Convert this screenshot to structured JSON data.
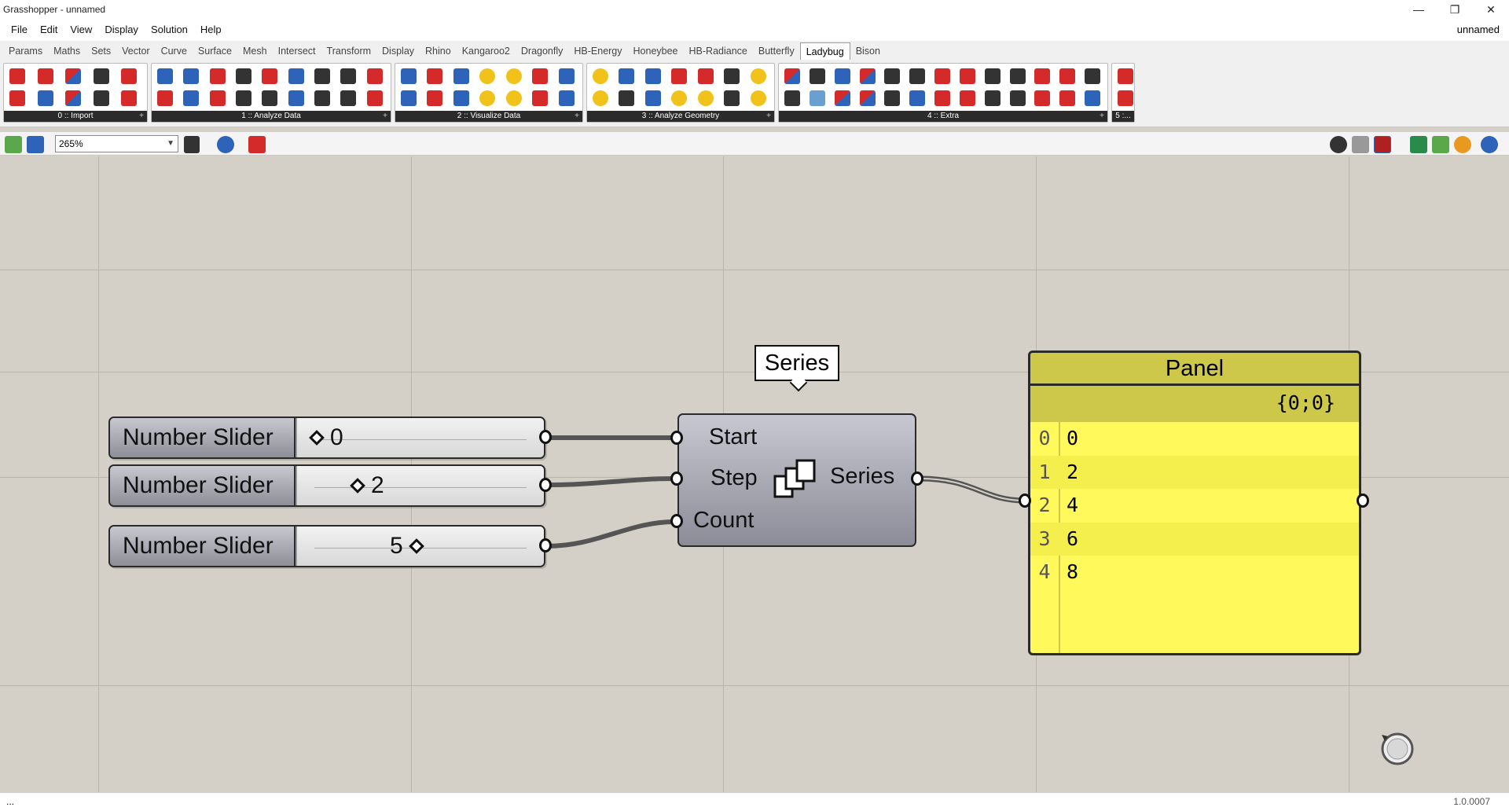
{
  "window": {
    "title": "Grasshopper - unnamed",
    "minimize": "—",
    "restore": "❐",
    "close": "✕"
  },
  "menu": {
    "items": [
      "File",
      "Edit",
      "View",
      "Display",
      "Solution",
      "Help"
    ],
    "doc_name": "unnamed"
  },
  "tabs": {
    "items": [
      "Params",
      "Maths",
      "Sets",
      "Vector",
      "Curve",
      "Surface",
      "Mesh",
      "Intersect",
      "Transform",
      "Display",
      "Rhino",
      "Kangaroo2",
      "Dragonfly",
      "HB-Energy",
      "Honeybee",
      "HB-Radiance",
      "Butterfly",
      "Ladybug",
      "Bison"
    ],
    "active": "Ladybug"
  },
  "ribbon": {
    "groups": [
      {
        "label": "0 :: Import"
      },
      {
        "label": "1 :: Analyze Data"
      },
      {
        "label": "2 :: Visualize Data"
      },
      {
        "label": "3 :: Analyze Geometry"
      },
      {
        "label": "4 :: Extra"
      },
      {
        "label": "5 :..."
      }
    ]
  },
  "canvas_toolbar": {
    "zoom": "265%"
  },
  "sliders": [
    {
      "label": "Number Slider",
      "value": "0"
    },
    {
      "label": "Number Slider",
      "value": "2"
    },
    {
      "label": "Number Slider",
      "value": "5"
    }
  ],
  "series": {
    "tooltip": "Series",
    "inputs": [
      "Start",
      "Step",
      "Count"
    ],
    "output": "Series"
  },
  "panel": {
    "title": "Panel",
    "path": "{0;0}",
    "rows": [
      {
        "index": "0",
        "value": "0"
      },
      {
        "index": "1",
        "value": "2"
      },
      {
        "index": "2",
        "value": "4"
      },
      {
        "index": "3",
        "value": "6"
      },
      {
        "index": "4",
        "value": "8"
      }
    ]
  },
  "status": {
    "left": "...",
    "version": "1.0.0007"
  }
}
